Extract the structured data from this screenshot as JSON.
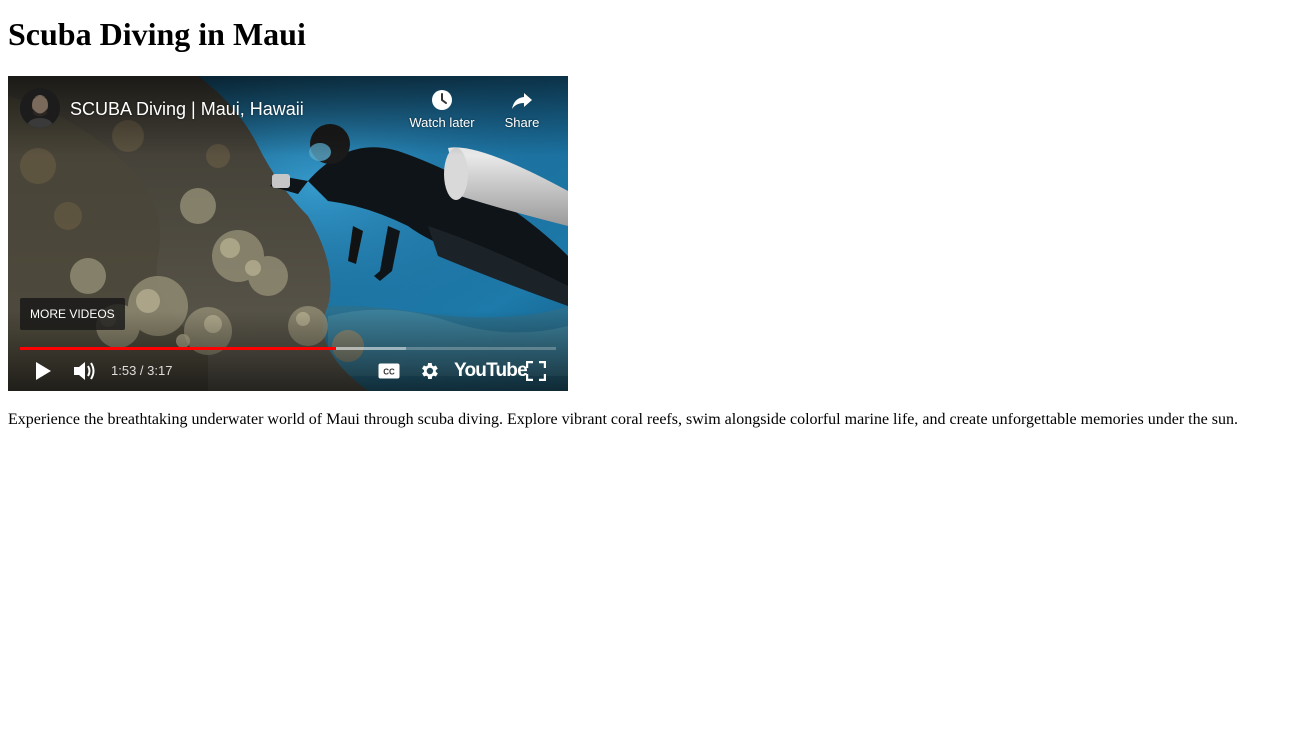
{
  "page": {
    "heading": "Scuba Diving in Maui",
    "description": "Experience the breathtaking underwater world of Maui through scuba diving. Explore vibrant coral reefs, swim alongside colorful marine life, and create unforgettable memories under the sun."
  },
  "video": {
    "title": "SCUBA Diving | Maui, Hawaii",
    "watch_later_label": "Watch later",
    "share_label": "Share",
    "more_videos_label": "MORE VIDEOS",
    "time_display": "1:53 / 3:17",
    "played_fraction": 0.59,
    "loaded_fraction": 0.72,
    "logo_text": "YouTube",
    "colors": {
      "progress_played": "#ff0000",
      "water": "#1a6e9e"
    },
    "icons": {
      "play": "play-icon",
      "volume": "volume-icon",
      "cc": "captions-icon",
      "settings": "gear-icon",
      "fullscreen": "fullscreen-icon",
      "watch_later": "clock-icon",
      "share": "share-arrow-icon"
    }
  }
}
